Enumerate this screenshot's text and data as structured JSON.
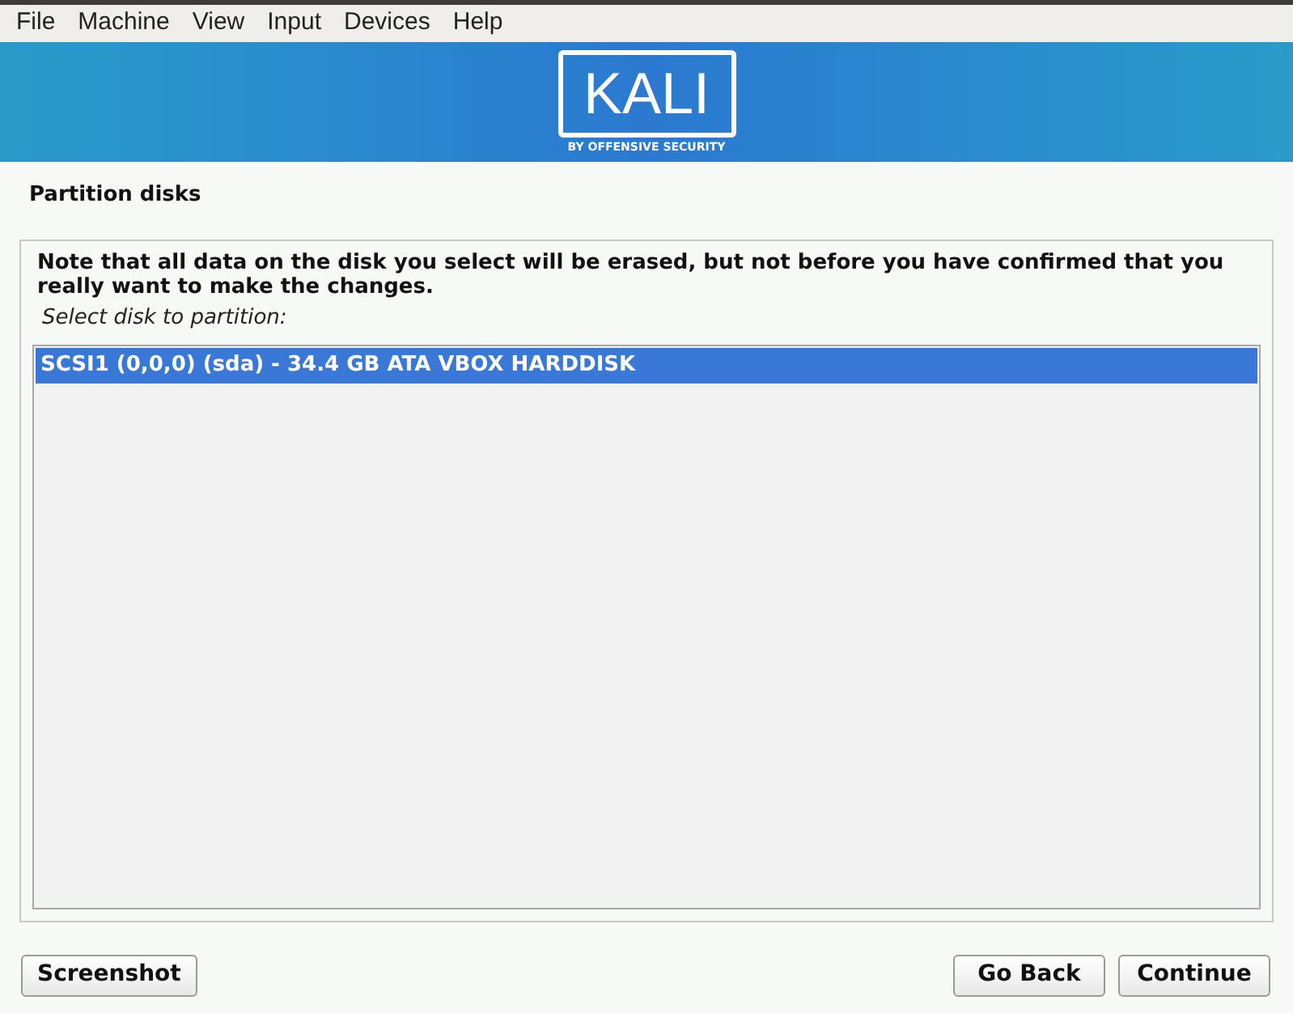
{
  "menu_bar": [
    "File",
    "Machine",
    "View",
    "Input",
    "Devices",
    "Help"
  ],
  "banner": {
    "logo": "KALI",
    "tagline": "BY OFFENSIVE SECURITY"
  },
  "page_title": "Partition disks",
  "note": "Note that all data on the disk you select will be erased, but not before you have confirmed that you really want to make the changes.",
  "list_label": "Select disk to partition:",
  "disks": [
    {
      "label": "SCSI1 (0,0,0) (sda) - 34.4 GB ATA VBOX HARDDISK",
      "selected": true
    }
  ],
  "buttons": {
    "left": [
      "Screenshot"
    ],
    "right": [
      "Go Back",
      "Continue"
    ]
  }
}
